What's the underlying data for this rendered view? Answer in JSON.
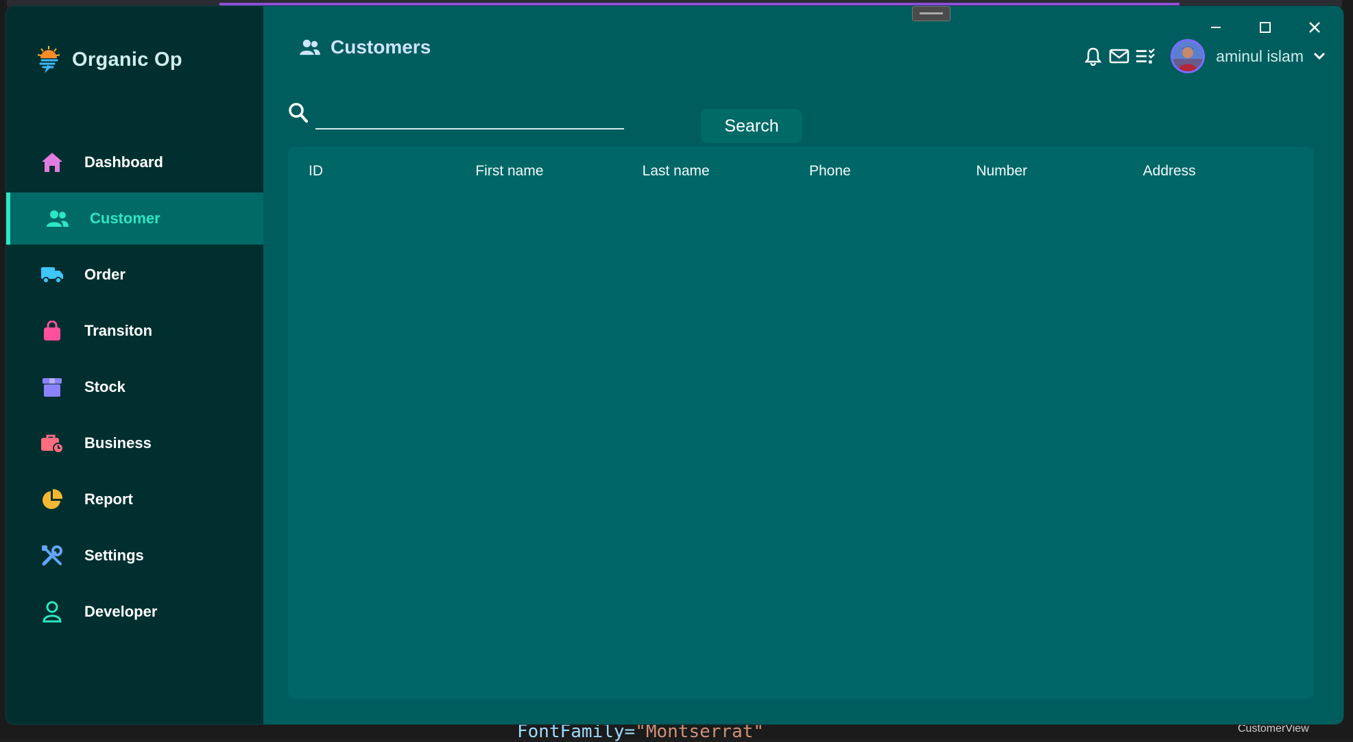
{
  "app": {
    "name": "Organic Op"
  },
  "page": {
    "title": "Customers"
  },
  "sidebar": {
    "items": [
      {
        "label": "Dashboard",
        "icon": "home-icon",
        "color": "#e37ce0"
      },
      {
        "label": "Customer",
        "icon": "users-icon",
        "color": "#2ee6c2",
        "active": true
      },
      {
        "label": "Order",
        "icon": "truck-icon",
        "color": "#3fc6ff"
      },
      {
        "label": "Transiton",
        "icon": "shopping-bag-icon",
        "color": "#ff4f9d"
      },
      {
        "label": "Stock",
        "icon": "box-icon",
        "color": "#8a82ff"
      },
      {
        "label": "Business",
        "icon": "briefcase-clock-icon",
        "color": "#ff6b7f"
      },
      {
        "label": "Report",
        "icon": "pie-chart-icon",
        "color": "#f5b731"
      },
      {
        "label": "Settings",
        "icon": "tools-icon",
        "color": "#64a6ff"
      },
      {
        "label": "Developer",
        "icon": "user-outline-icon",
        "color": "#2ee6c2"
      }
    ]
  },
  "topbar": {
    "user_name": "aminul islam",
    "icons": [
      "bell-icon",
      "mail-icon",
      "tasks-icon"
    ]
  },
  "search": {
    "value": "",
    "button_label": "Search"
  },
  "table": {
    "columns": [
      "ID",
      "First name",
      "Last name",
      "Phone",
      "Number",
      "Address"
    ],
    "rows": []
  },
  "background_editor": {
    "code_attr": "FontFamily=",
    "code_value": "\"Montserrat\"",
    "tab_label": "CustomerView"
  },
  "colors": {
    "sidebar_bg": "#012f2f",
    "main_bg": "#005d5e",
    "accent": "#2ee6c2",
    "card_bg": "#006766"
  }
}
